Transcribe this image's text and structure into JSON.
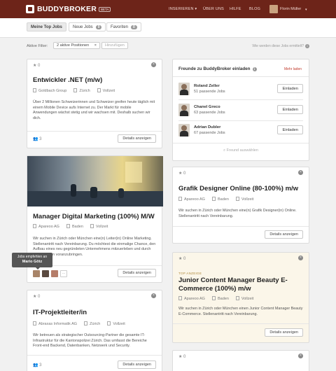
{
  "header": {
    "logo": "BUDDYBROKER",
    "beta": "BETA",
    "nav": [
      "INSERIEREN ▾",
      "ÜBER UNS",
      "HILFE",
      "BLOG"
    ],
    "user": "Florin Müller",
    "brand_color": "#6d2419"
  },
  "tabs": [
    {
      "label": "Meine Top Jobs",
      "count": null
    },
    {
      "label": "Neue Jobs",
      "count": "0"
    },
    {
      "label": "Favoriten",
      "count": "0"
    }
  ],
  "filter": {
    "label": "Aktive Filter:",
    "chip": "2 aktive Positionen",
    "chip_close": "×",
    "add": "Hinzufügen",
    "help": "Wie werden diese Jobs ermittelt?"
  },
  "jobs": [
    {
      "likes": "0",
      "title": "Entwickler .NET (m/w)",
      "company": "Goldbach Group",
      "location": "Zürich",
      "type": "Vollzeit",
      "desc": "Über 2 Millionen Schweizerinnen und Schweizer greifen heute täglich mit einem Mobile Device aufs Internet zu. Der Markt für mobile Anwendungen wächst stetig und wir wachsen mit. Deshalb suchen wir dich.",
      "footer_count": "3",
      "button": "Details anzeigen"
    },
    {
      "likes": "0",
      "title": "Manager Digital Marketing (100%) M/W",
      "company": "Apareoo AG",
      "location": "Baden",
      "type": "Vollzeit",
      "desc": "Wir suchen in Zürich oder München eine(n) Leiter(in) Online Marketing. Stellenantritt nach Vereinbarung. Du möchtest die einmalige Chance, den Aufbau eines neu gegründeten Unternehmens mitzuerleben und durch eigene Ideen voranzubringen.",
      "button": "Details anzeigen",
      "tooltip_line1": "Jobs empfehlen an",
      "tooltip_line2": "Mario Götz",
      "more": "···"
    },
    {
      "likes": "0",
      "title": "IT-Projektleiter/in",
      "company": "Abraxas Informatik AG",
      "location": "Zürich",
      "type": "Vollzeit",
      "desc": "Wir betreuen als strategischer Outsourcing-Partner die gesamte IT-Infrastruktur für die Kantonspolizei Zürich. Das umfasst die Bereiche Front-end Backend, Datenbanken, Netzwerk und Security.",
      "footer_count": "3",
      "button": "Details anzeigen"
    },
    {
      "likes": "0",
      "title": "Grafik Designer Online (80-100%) m/w",
      "company": "Apareoo AG",
      "location": "Baden",
      "type": "Vollzeit",
      "desc": "Wir suchen in Zürich oder München eine(n) Grafik Designer(in) Online. Stellenantritt nach Vereinbarung.",
      "button": "Details anzeigen"
    },
    {
      "likes": "0",
      "tag": "TOP ANZEIGE",
      "title": "Junior Content Manager Beauty E-Commerce (100%) m/w",
      "company": "Apareoo AG",
      "location": "Baden",
      "type": "Vollzeit",
      "desc": "Wir suchen in Zürich oder München einen Junior Content Manager Beauty E-Commerce. Stellenantritt nach Vereinbarung.",
      "button": "Details anzeigen"
    },
    {
      "likes": "0"
    }
  ],
  "friends": {
    "title": "Freunde zu BuddyBroker einladen",
    "more": "Mehr laden",
    "list": [
      {
        "name": "Roland Zeller",
        "jobs": "51 passende Jobs"
      },
      {
        "name": "Chanel Greco",
        "jobs": "63 passende Jobs"
      },
      {
        "name": "Adrian Dubler",
        "jobs": "67 passende Jobs"
      }
    ],
    "invite_label": "Einladen",
    "search": "Freund auswählen"
  }
}
